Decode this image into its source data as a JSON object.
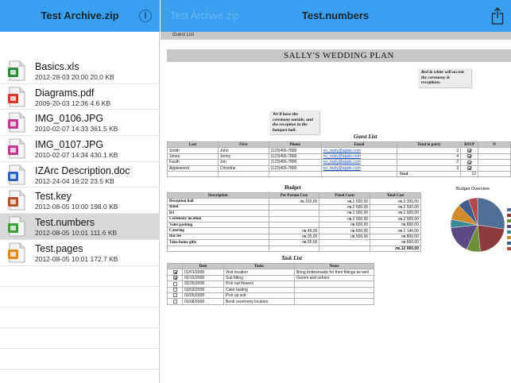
{
  "left_panel": {
    "title": "Test Archive.zip",
    "info_glyph": "i",
    "files": [
      {
        "name": "Basics.xls",
        "meta": "2012-28-03 20:00  20.0 KB",
        "icon": "excel-file-icon",
        "color": "#2f8a3b",
        "selected": false
      },
      {
        "name": "Diagrams.pdf",
        "meta": "2009-20-03 12:36  4.6 KB",
        "icon": "pdf-file-icon",
        "color": "#d9352b",
        "selected": false
      },
      {
        "name": "IMG_0106.JPG",
        "meta": "2010-02-07 14:33  361.5 KB",
        "icon": "image-file-icon",
        "color": "#c23a8f",
        "selected": false
      },
      {
        "name": "IMG_0107.JPG",
        "meta": "2010-02-07 14:34  430.1 KB",
        "icon": "image-file-icon",
        "color": "#c23a8f",
        "selected": false
      },
      {
        "name": "IZArc Description.doc",
        "meta": "2012-24-04 19:22  23.5 KB",
        "icon": "word-file-icon",
        "color": "#2c63b8",
        "selected": false
      },
      {
        "name": "Test.key",
        "meta": "2012-08-05 10:00  198.0 KB",
        "icon": "keynote-file-icon",
        "color": "#b5542a",
        "selected": false
      },
      {
        "name": "Test.numbers",
        "meta": "2012-08-05 10:01  111.6 KB",
        "icon": "numbers-file-icon",
        "color": "#3a9d3a",
        "selected": true
      },
      {
        "name": "Test.pages",
        "meta": "2012-08-05 10:01  172.7 KB",
        "icon": "pages-file-icon",
        "color": "#e08a1e",
        "selected": false
      }
    ]
  },
  "right_panel": {
    "back_label": "Test Archive.zip",
    "title": "Test.numbers",
    "sheet_tab": "Guest List"
  },
  "doc": {
    "banner": "SALLY'S WEDDING PLAN",
    "note_top": "Red & white will accent the ceremony & receptions.",
    "note_mid": "We'll have the ceremony outside, and the reception in the banquet hall.",
    "guest_title": "Guest List",
    "guest_headers": [
      "Last",
      "First",
      "Phone",
      "Email",
      "Total in party",
      "RSVP",
      "N"
    ],
    "guests": [
      {
        "last": "Smith",
        "first": "John",
        "phone": "(123)456-7890",
        "email": "no_reply@apple.com",
        "party": "3",
        "rsvp": true
      },
      {
        "last": "Jones",
        "first": "Jenny",
        "phone": "(123)456-7890",
        "email": "no_reply@apple.com",
        "party": "4",
        "rsvp": true
      },
      {
        "last": "Fauth",
        "first": "Jon",
        "phone": "(123)456-7890",
        "email": "no_reply@apple.com",
        "party": "2",
        "rsvp": true
      },
      {
        "last": "Applewood",
        "first": "Christine",
        "phone": "(123)456-7890",
        "email": "no_reply@apple.com",
        "party": "3",
        "rsvp": true
      }
    ],
    "guest_total_label": "Total",
    "guest_total": "12",
    "budget_title": "Budget",
    "budget_headers": [
      "Description",
      "Per Person Cost",
      "Fixed Costs",
      "Total Cost"
    ],
    "budget": [
      {
        "desc": "Reception hall",
        "pp": "лв.150,00",
        "fixed": "лв.1 500,00",
        "total": "лв.3 300,00"
      },
      {
        "desc": "Band",
        "pp": "",
        "fixed": "лв.2 500,00",
        "total": "лв.2 500,00"
      },
      {
        "desc": "DJ",
        "pp": "",
        "fixed": "лв.1 000,00",
        "total": "лв.1 000,00"
      },
      {
        "desc": "Ceremony location",
        "pp": "",
        "fixed": "лв.2 000,00",
        "total": "лв.2 000,00"
      },
      {
        "desc": "Valet parking",
        "pp": "",
        "fixed": "лв.600,00",
        "total": "лв.600,00"
      },
      {
        "desc": "Catering",
        "pp": "лв.45,00",
        "fixed": "лв.600,00",
        "total": "лв.1 140,00"
      },
      {
        "desc": "Bar fee",
        "pp": "лв.25,00",
        "fixed": "лв.500,00",
        "total": "лв.800,00"
      },
      {
        "desc": "Take-home gifts",
        "pp": "лв.55,00",
        "fixed": "",
        "total": "лв.660,00"
      }
    ],
    "budget_total": "лв.12 000,00",
    "task_title": "Task List",
    "task_headers": [
      "Date",
      "Tasks",
      "Notes"
    ],
    "tasks": [
      {
        "done": true,
        "date": "01/01/2008",
        "task": "Visit location",
        "notes": "Bring bridesmaids for their fittings as well"
      },
      {
        "done": true,
        "date": "02/15/2008",
        "task": "Suit fitting",
        "notes": "Groom and ushers"
      },
      {
        "done": false,
        "date": "02/25/2008",
        "task": "Pick out flowers",
        "notes": ""
      },
      {
        "done": false,
        "date": "03/03/2008",
        "task": "Cake tasting",
        "notes": ""
      },
      {
        "done": false,
        "date": "03/05/2008",
        "task": "Pick up suit",
        "notes": ""
      },
      {
        "done": false,
        "date": "03/08/2008",
        "task": "Book ceremony location",
        "notes": ""
      }
    ],
    "pie_title": "Budget Overview",
    "pie_colors": [
      "#4f6f97",
      "#8a3b3b",
      "#6e8f3a",
      "#5c4b82",
      "#3a8a96",
      "#d08a2a",
      "#3f5f8a",
      "#b04a4a"
    ]
  }
}
